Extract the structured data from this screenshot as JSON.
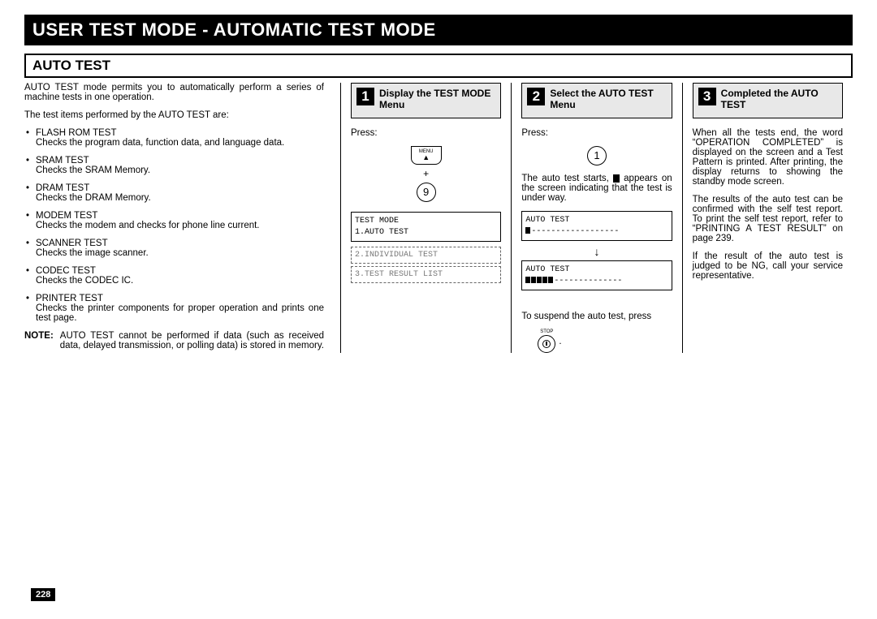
{
  "title": "USER TEST MODE - AUTOMATIC TEST MODE",
  "section_heading": "AUTO TEST",
  "intro": {
    "p1": "AUTO TEST mode permits you to automatically perform a series of machine tests in one operation.",
    "p2": "The test items performed by the AUTO TEST are:"
  },
  "tests": [
    {
      "name": "FLASH ROM TEST",
      "desc": "Checks the program data, function data, and language data."
    },
    {
      "name": "SRAM TEST",
      "desc": "Checks the SRAM Memory."
    },
    {
      "name": "DRAM TEST",
      "desc": "Checks the DRAM Memory."
    },
    {
      "name": "MODEM TEST",
      "desc": "Checks the modem and checks for phone line current."
    },
    {
      "name": "SCANNER TEST",
      "desc": "Checks the image scanner."
    },
    {
      "name": "CODEC TEST",
      "desc": "Checks the CODEC IC."
    },
    {
      "name": "PRINTER TEST",
      "desc": "Checks the printer components for proper operation and prints one test page."
    }
  ],
  "note": {
    "label": "NOTE:",
    "body": "AUTO TEST cannot be performed if data (such as received data, delayed transmission, or polling data) is stored in memory."
  },
  "steps": {
    "s1": {
      "num": "1",
      "title": "Display the TEST MODE Menu",
      "press": "Press:",
      "menu_label": "MENU",
      "plus": "+",
      "digit": "9",
      "lcd": "TEST MODE\n1.AUTO TEST",
      "dashed1": "2.INDIVIDUAL TEST",
      "dashed2": "3.TEST RESULT LIST"
    },
    "s2": {
      "num": "2",
      "title": "Select the AUTO TEST Menu",
      "press": "Press:",
      "digit": "1",
      "para_a": "The auto test starts, ",
      "para_b": " appears on the screen indicating that the test is under way.",
      "lcd1_label": "AUTO TEST",
      "lcd1_dash": "------------------",
      "lcd2_label": "AUTO TEST",
      "lcd2_dash": "--------------",
      "suspend": "To suspend the auto test, press",
      "stop_label": "STOP",
      "period": "."
    },
    "s3": {
      "num": "3",
      "title": "Completed the AUTO TEST",
      "p1": "When all the tests end, the word “OPERATION COMPLETED” is displayed on the screen and a Test Pattern is printed. After printing, the display returns to showing the standby mode screen.",
      "p2": "The results of the auto test can be confirmed with the self test report. To print the self test report, refer to “PRINTING A TEST RESULT” on page 239.",
      "p3": "If the result of the auto test is judged to be NG, call your service representative."
    }
  },
  "page_number": "228"
}
